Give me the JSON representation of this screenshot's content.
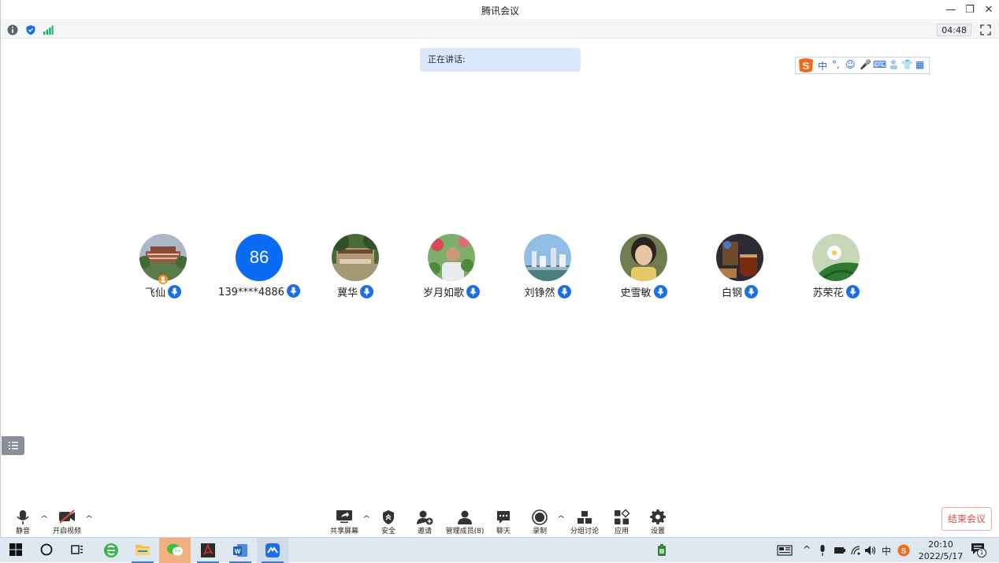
{
  "window": {
    "title": "腾讯会议",
    "minimize_label": "—",
    "restore_label": "❐",
    "close_label": "✕"
  },
  "infobar": {
    "duration": "04:48"
  },
  "speaking": {
    "label": "正在讲话:"
  },
  "ime": {
    "items": [
      "中",
      "°,",
      "☺",
      "🎤",
      "⌨",
      "👕",
      "▦"
    ]
  },
  "participants": [
    {
      "name": "飞仙",
      "avatar": "campus-photo",
      "host": true
    },
    {
      "name": "139****4886",
      "avatar_text": "86",
      "avatar_color": "#0a6cf2"
    },
    {
      "name": "冀华",
      "avatar": "gate-photo"
    },
    {
      "name": "岁月如歌",
      "avatar": "person-flowers-photo"
    },
    {
      "name": "刘铮然",
      "avatar": "city-photo"
    },
    {
      "name": "史雪敏",
      "avatar": "woman-photo"
    },
    {
      "name": "白钢",
      "avatar": "tea-photo"
    },
    {
      "name": "苏荣花",
      "avatar": "flower-photo"
    }
  ],
  "toolbar": {
    "mute": "静音",
    "video": "开启视频",
    "share": "共享屏幕",
    "security": "安全",
    "invite": "邀请",
    "members": "管理成员(8)",
    "chat": "聊天",
    "record": "录制",
    "breakout": "分组讨论",
    "apps": "应用",
    "settings": "设置",
    "end": "结束会议"
  },
  "taskbar": {
    "time": "20:10",
    "date": "2022/5/17",
    "ime_indicator": "中",
    "notification_count": "1"
  },
  "colors": {
    "accent": "#0a6cf2",
    "speaking_bg": "#dbe8fb",
    "end_red": "#e5483d"
  }
}
